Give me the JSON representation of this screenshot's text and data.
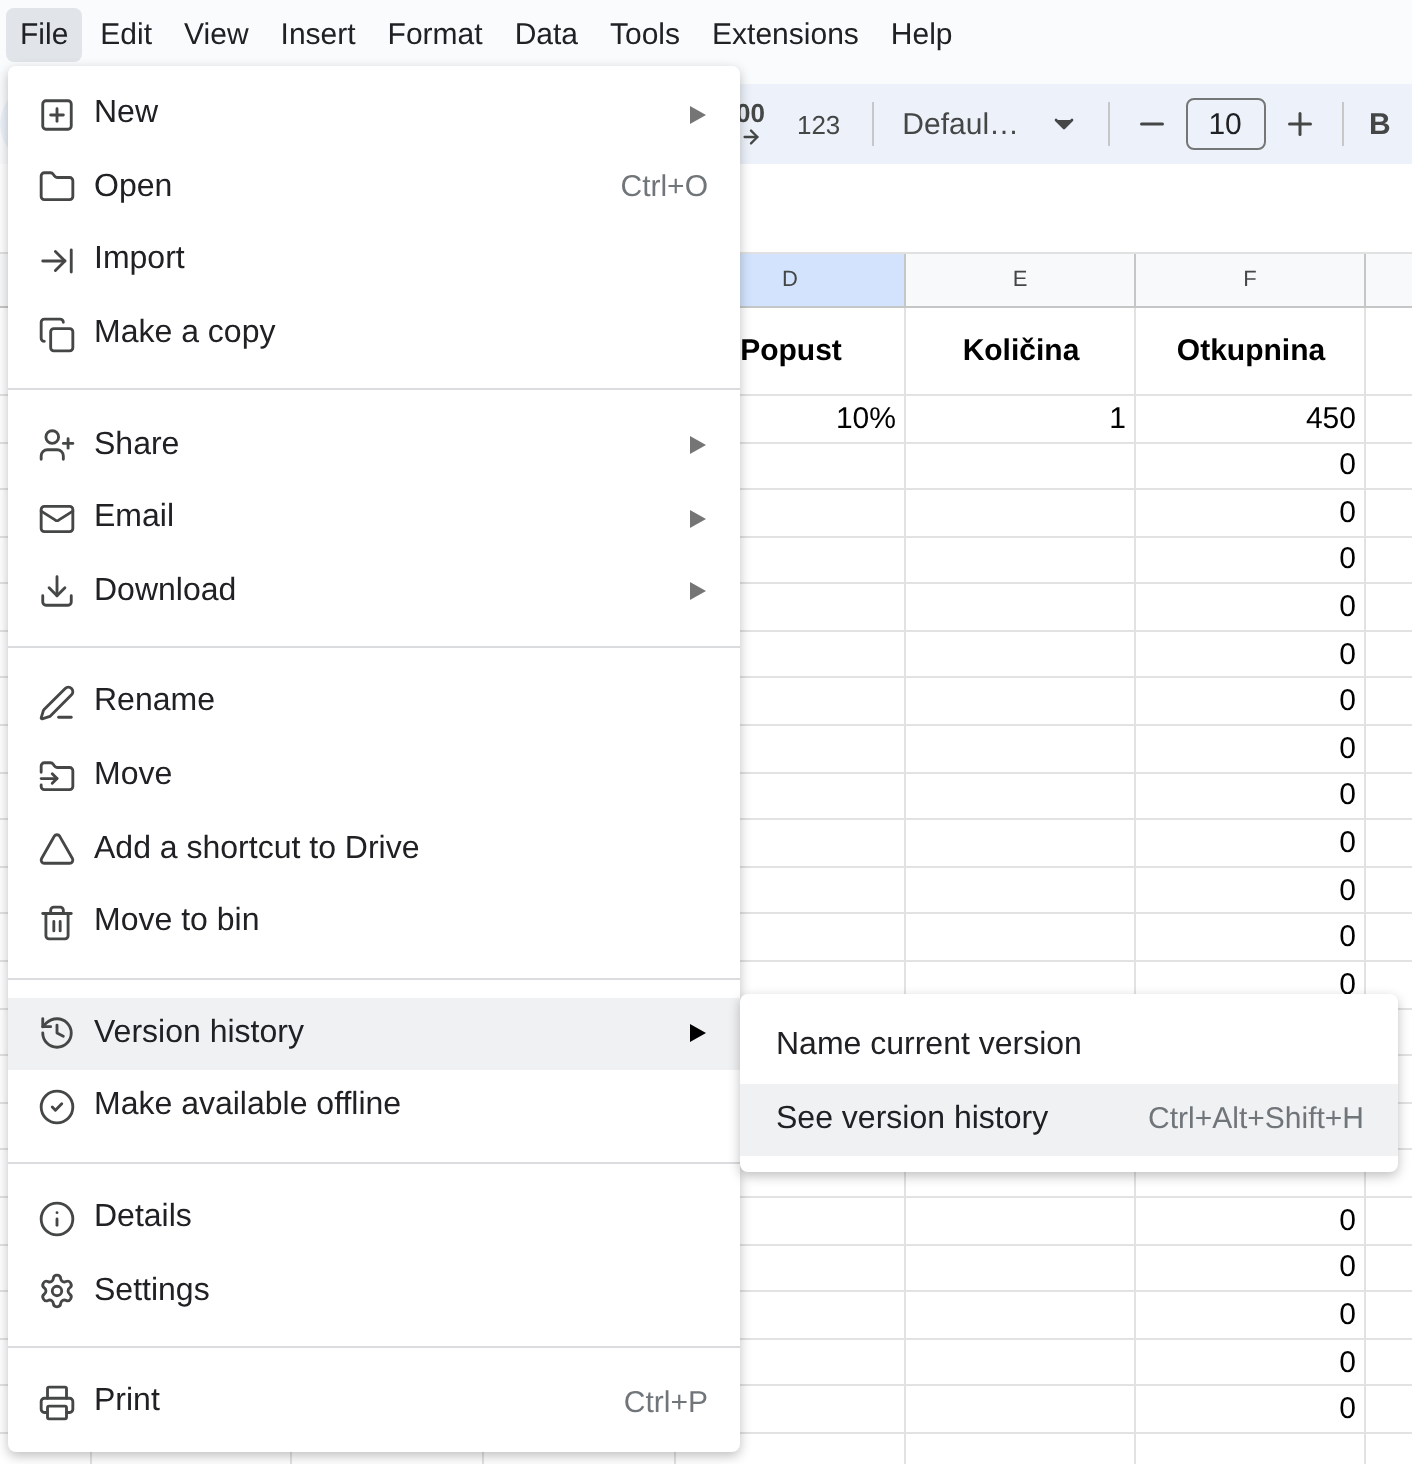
{
  "menubar": [
    {
      "label": "File",
      "selected": true
    },
    {
      "label": "Edit",
      "selected": false
    },
    {
      "label": "View",
      "selected": false
    },
    {
      "label": "Insert",
      "selected": false
    },
    {
      "label": "Format",
      "selected": false
    },
    {
      "label": "Data",
      "selected": false
    },
    {
      "label": "Tools",
      "selected": false
    },
    {
      "label": "Extensions",
      "selected": false
    },
    {
      "label": "Help",
      "selected": false
    }
  ],
  "toolbar": {
    "decimal_button": "00",
    "format_button": "123",
    "font": "Defaul…",
    "font_size": "10",
    "bold_button": "B"
  },
  "columns": [
    {
      "label": "D",
      "selected": true
    },
    {
      "label": "E",
      "selected": false
    },
    {
      "label": "F",
      "selected": false
    }
  ],
  "header_row": [
    "Popust",
    "Količina",
    "Otkupnina"
  ],
  "data_row": [
    "10%",
    "1",
    "450"
  ],
  "f_values_above_submenu": [
    "0",
    "0",
    "0",
    "0",
    "0",
    "0",
    "0",
    "0",
    "0",
    "0",
    "0",
    "0"
  ],
  "f_values_below_submenu": [
    "0",
    "0",
    "0",
    "0",
    "0"
  ],
  "file_menu": {
    "groups": [
      [
        {
          "label": "New",
          "submenu": true,
          "selected": false
        },
        {
          "label": "Open",
          "shortcut": "Ctrl+O",
          "submenu": false,
          "selected": false
        },
        {
          "label": "Import",
          "submenu": false,
          "selected": false
        },
        {
          "label": "Make a copy",
          "submenu": false,
          "selected": false
        }
      ],
      [
        {
          "label": "Share",
          "submenu": true,
          "selected": false
        },
        {
          "label": "Email",
          "submenu": true,
          "selected": false
        },
        {
          "label": "Download",
          "submenu": true,
          "selected": false
        }
      ],
      [
        {
          "label": "Rename",
          "submenu": false,
          "selected": false
        },
        {
          "label": "Move",
          "submenu": false,
          "selected": false
        },
        {
          "label": "Add a shortcut to Drive",
          "submenu": false,
          "selected": false
        },
        {
          "label": "Move to bin",
          "submenu": false,
          "selected": false
        }
      ],
      [
        {
          "label": "Version history",
          "submenu": true,
          "selected": true
        },
        {
          "label": "Make available offline",
          "submenu": false,
          "selected": false
        }
      ],
      [
        {
          "label": "Details",
          "submenu": false,
          "selected": false
        },
        {
          "label": "Settings",
          "submenu": false,
          "selected": false
        }
      ],
      [
        {
          "label": "Print",
          "shortcut": "Ctrl+P",
          "submenu": false,
          "selected": false
        }
      ]
    ]
  },
  "version_submenu": [
    {
      "label": "Name current version",
      "selected": false
    },
    {
      "label": "See version history",
      "shortcut": "Ctrl+Alt+Shift+H",
      "selected": true
    }
  ]
}
